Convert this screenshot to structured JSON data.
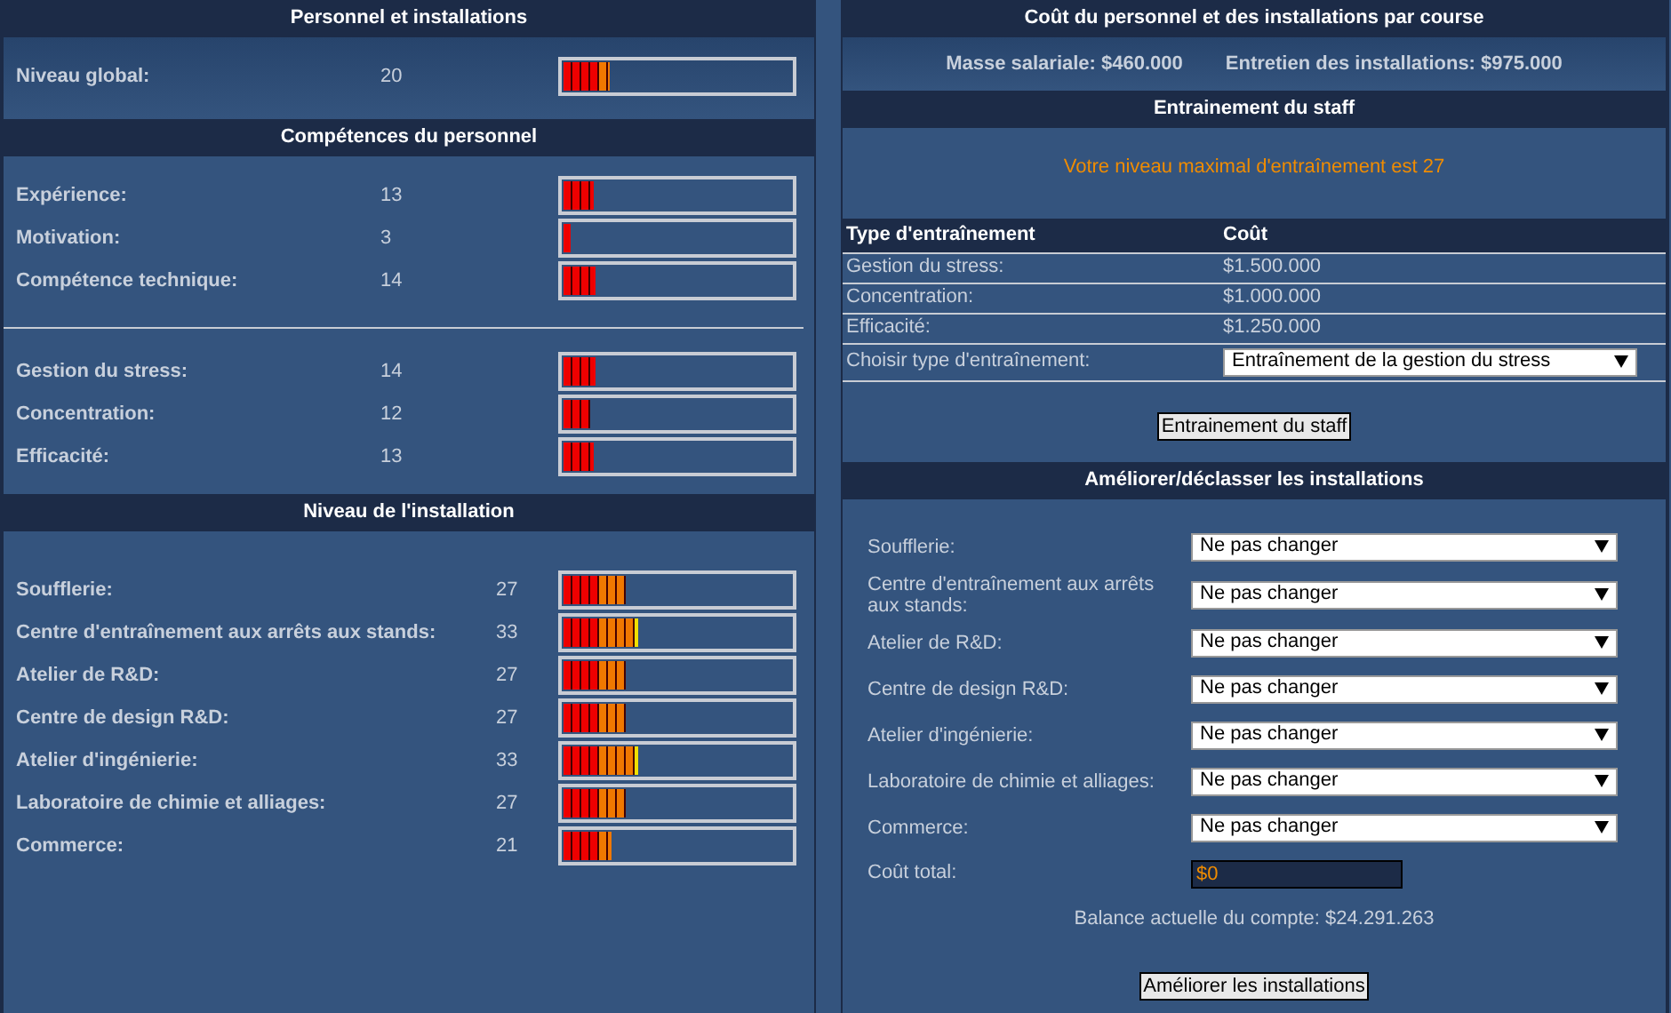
{
  "staff_panel": {
    "title": "Personnel et installations",
    "overall": {
      "label": "Niveau global:",
      "value": "20",
      "level": 0.2
    },
    "skills_title": "Compétences du personnel",
    "skill_groups": [
      [
        {
          "label": "Expérience:",
          "value": "13",
          "level": 0.13
        },
        {
          "label": "Motivation:",
          "value": "3",
          "level": 0.03
        },
        {
          "label": "Compétence technique:",
          "value": "14",
          "level": 0.14
        }
      ],
      [
        {
          "label": "Gestion du stress:",
          "value": "14",
          "level": 0.14
        },
        {
          "label": "Concentration:",
          "value": "12",
          "level": 0.12
        },
        {
          "label": "Efficacité:",
          "value": "13",
          "level": 0.13
        }
      ]
    ],
    "facilities_title": "Niveau de l'installation",
    "facilities": [
      {
        "label": "Soufflerie:",
        "value": "27",
        "level": 0.27
      },
      {
        "label": "Centre d'entraînement aux arrêts aux stands:",
        "value": "33",
        "level": 0.33
      },
      {
        "label": "Atelier de R&D:",
        "value": "27",
        "level": 0.27
      },
      {
        "label": "Centre de design R&D:",
        "value": "27",
        "level": 0.27
      },
      {
        "label": "Atelier d'ingénierie:",
        "value": "33",
        "level": 0.33
      },
      {
        "label": "Laboratoire de chimie et alliages:",
        "value": "27",
        "level": 0.27
      },
      {
        "label": "Commerce:",
        "value": "21",
        "level": 0.21
      }
    ]
  },
  "cost_panel": {
    "title": "Coût du personnel et des installations par course",
    "items": [
      "Masse salariale: $460.000",
      "Entretien des installations: $975.000"
    ],
    "training": {
      "title": "Entrainement du staff",
      "notice": "Votre niveau maximal d'entraînement est 27",
      "columns": [
        "Type d'entraînement",
        "Coût"
      ],
      "rows": [
        {
          "type": "Gestion du stress:",
          "cost": "$1.500.000"
        },
        {
          "type": "Concentration:",
          "cost": "$1.000.000"
        },
        {
          "type": "Efficacité:",
          "cost": "$1.250.000"
        }
      ],
      "select": {
        "label": "Choisir type d'entraînement:",
        "value": "Entraînement de la gestion du stress"
      },
      "button": "Entrainement du staff"
    },
    "upgrade": {
      "title": "Améliorer/déclasser les installations",
      "rows": [
        {
          "label": "Soufflerie:",
          "value": "Ne pas changer"
        },
        {
          "label": "Centre d'entraînement aux arrêts aux stands:",
          "value": "Ne pas changer"
        },
        {
          "label": "Atelier de R&D:",
          "value": "Ne pas changer"
        },
        {
          "label": "Centre de design R&D:",
          "value": "Ne pas changer"
        },
        {
          "label": "Atelier d'ingénierie:",
          "value": "Ne pas changer"
        },
        {
          "label": "Laboratoire de chimie et alliages:",
          "value": "Ne pas changer"
        },
        {
          "label": "Commerce:",
          "value": "Ne pas changer"
        }
      ],
      "total": {
        "label": "Coût total:",
        "value": "$0"
      },
      "balance": "Balance actuelle du compte: $24.291.263",
      "button": "Améliorer les installations"
    }
  }
}
